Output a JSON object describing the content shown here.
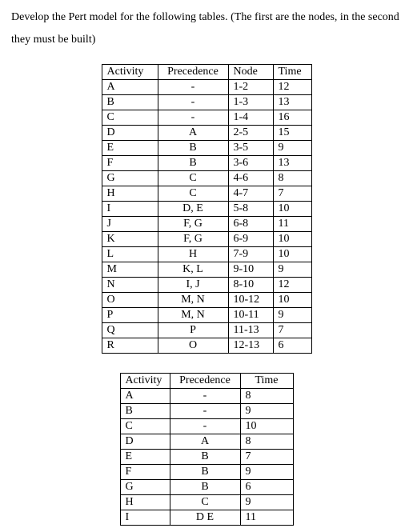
{
  "intro": "Develop the Pert model for the following tables. (The first are the nodes, in the second they must be built)",
  "table1": {
    "headers": {
      "activity": "Activity",
      "precedence": "Precedence",
      "node": "Node",
      "time": "Time"
    },
    "rows": [
      {
        "activity": "A",
        "precedence": "-",
        "node": "1-2",
        "time": "12"
      },
      {
        "activity": "B",
        "precedence": "-",
        "node": "1-3",
        "time": "13"
      },
      {
        "activity": "C",
        "precedence": "-",
        "node": "1-4",
        "time": "16"
      },
      {
        "activity": "D",
        "precedence": "A",
        "node": "2-5",
        "time": "15"
      },
      {
        "activity": "E",
        "precedence": "B",
        "node": "3-5",
        "time": "9"
      },
      {
        "activity": "F",
        "precedence": "B",
        "node": "3-6",
        "time": "13"
      },
      {
        "activity": "G",
        "precedence": "C",
        "node": "4-6",
        "time": "8"
      },
      {
        "activity": "H",
        "precedence": "C",
        "node": "4-7",
        "time": "7"
      },
      {
        "activity": "I",
        "precedence": "D, E",
        "node": "5-8",
        "time": "10"
      },
      {
        "activity": "J",
        "precedence": "F, G",
        "node": "6-8",
        "time": "11"
      },
      {
        "activity": "K",
        "precedence": "F, G",
        "node": "6-9",
        "time": "10"
      },
      {
        "activity": "L",
        "precedence": "H",
        "node": "7-9",
        "time": "10"
      },
      {
        "activity": "M",
        "precedence": "K, L",
        "node": "9-10",
        "time": "9"
      },
      {
        "activity": "N",
        "precedence": "I, J",
        "node": "8-10",
        "time": "12"
      },
      {
        "activity": "O",
        "precedence": "M, N",
        "node": "10-12",
        "time": "10"
      },
      {
        "activity": "P",
        "precedence": "M, N",
        "node": "10-11",
        "time": "9"
      },
      {
        "activity": "Q",
        "precedence": "P",
        "node": "11-13",
        "time": "7"
      },
      {
        "activity": "R",
        "precedence": "O",
        "node": "12-13",
        "time": "6"
      }
    ]
  },
  "table2": {
    "headers": {
      "activity": "Activity",
      "precedence": "Precedence",
      "time": "Time"
    },
    "rows": [
      {
        "activity": "A",
        "precedence": "-",
        "time": "8"
      },
      {
        "activity": "B",
        "precedence": "-",
        "time": "9"
      },
      {
        "activity": "C",
        "precedence": "-",
        "time": "10"
      },
      {
        "activity": "D",
        "precedence": "A",
        "time": "8"
      },
      {
        "activity": "E",
        "precedence": "B",
        "time": "7"
      },
      {
        "activity": "F",
        "precedence": "B",
        "time": "9"
      },
      {
        "activity": "G",
        "precedence": "B",
        "time": "6"
      },
      {
        "activity": "H",
        "precedence": "C",
        "time": "9"
      },
      {
        "activity": "I",
        "precedence": "D E",
        "time": "11"
      }
    ]
  }
}
